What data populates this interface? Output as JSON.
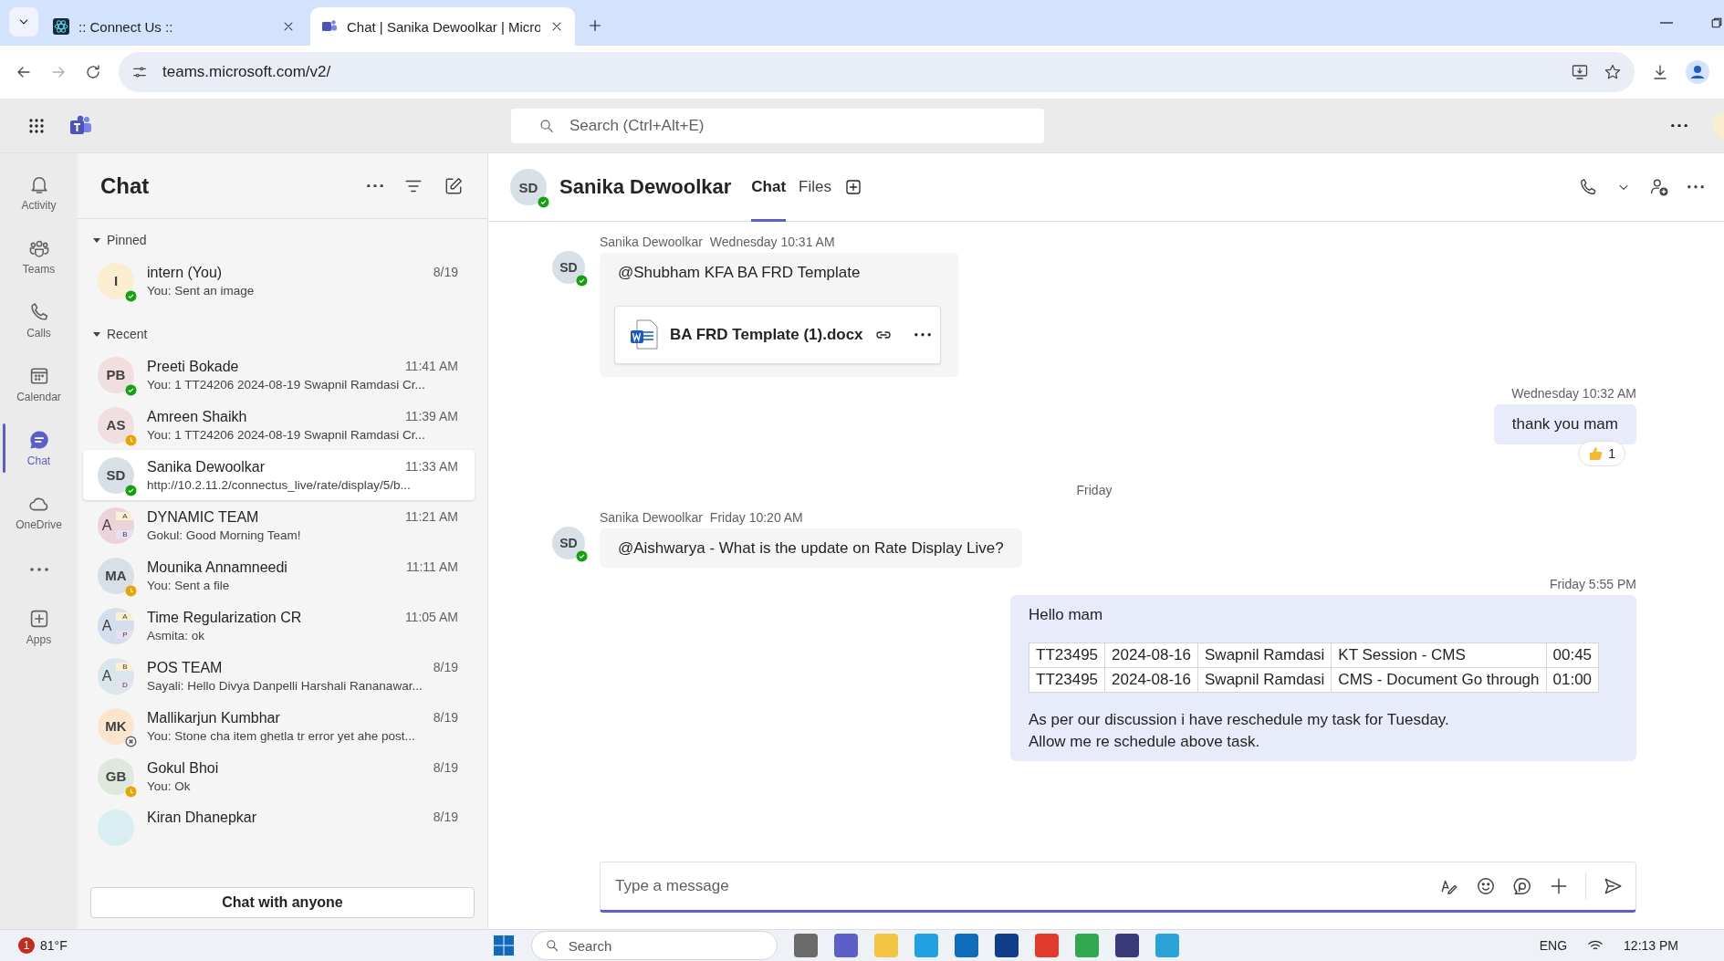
{
  "browser": {
    "tabs": [
      {
        "title": ":: Connect Us ::",
        "selected": false
      },
      {
        "title": "Chat | Sanika Dewoolkar | Micro",
        "selected": true
      }
    ],
    "url": "teams.microsoft.com/v2/"
  },
  "topbar": {
    "search_placeholder": "Search (Ctrl+Alt+E)"
  },
  "rail": [
    {
      "kind": "activity",
      "label": "Activity",
      "selected": false
    },
    {
      "kind": "teams",
      "label": "Teams",
      "selected": false
    },
    {
      "kind": "calls",
      "label": "Calls",
      "selected": false
    },
    {
      "kind": "calendar",
      "label": "Calendar",
      "selected": false
    },
    {
      "kind": "chat",
      "label": "Chat",
      "selected": true
    },
    {
      "kind": "onedrive",
      "label": "OneDrive",
      "selected": false
    },
    {
      "kind": "more"
    },
    {
      "kind": "apps",
      "label": "Apps",
      "selected": false
    }
  ],
  "chat_list": {
    "title": "Chat",
    "sections": [
      {
        "label": "Pinned",
        "expanded": true,
        "items": [
          {
            "name": "intern (You)",
            "time": "8/19",
            "preview": "You: Sent an image",
            "initials": "I",
            "color": "#fbedcf",
            "status": {
              "kind": "available",
              "color": "#13a10e"
            },
            "selected": false
          }
        ]
      },
      {
        "label": "Recent",
        "expanded": true,
        "items": [
          {
            "name": "Preeti Bokade",
            "time": "11:41 AM",
            "preview": "You: 1 TT24206 2024-08-19 Swapnil Ramdasi Cr...",
            "initials": "PB",
            "color": "#f1dede",
            "status": {
              "kind": "available",
              "color": "#13a10e"
            },
            "selected": false
          },
          {
            "name": "Amreen Shaikh",
            "time": "11:39 AM",
            "preview": "You: 1 TT24206 2024-08-19 Swapnil Ramdasi Cr...",
            "initials": "AS",
            "color": "#f1dede",
            "status": {
              "kind": "away",
              "color": "#eaa300"
            },
            "selected": false
          },
          {
            "name": "Sanika Dewoolkar",
            "time": "11:33 AM",
            "preview": "http://10.2.11.2/connectus_live/rate/display/5/b...",
            "initials": "SD",
            "color": "#d6e0e6",
            "status": {
              "kind": "available",
              "color": "#13a10e"
            },
            "selected": true
          },
          {
            "name": "DYNAMIC TEAM",
            "time": "11:21 AM",
            "preview": "Gokul: Good Morning Team!",
            "group": {
              "main": "A",
              "small": [
                "A",
                "B"
              ]
            },
            "color": "#ecd3d9",
            "selected": false
          },
          {
            "name": "Mounika Annamneedi",
            "time": "11:11 AM",
            "preview": "You: Sent a file",
            "initials": "MA",
            "color": "#d6e0e6",
            "status": {
              "kind": "away",
              "color": "#eaa300"
            },
            "selected": false
          },
          {
            "name": "Time Regularization CR",
            "time": "11:05 AM",
            "preview": "Asmita: ok",
            "group": {
              "main": "A",
              "small": [
                "A",
                "P"
              ]
            },
            "color": "#d3deef",
            "selected": false
          },
          {
            "name": "POS TEAM",
            "time": "8/19",
            "preview": "Sayali: Hello Divya Danpelli Harshali Rananawar...",
            "group": {
              "main": "A",
              "small": [
                "B",
                "D"
              ]
            },
            "color": "#d9e6ec",
            "selected": false
          },
          {
            "name": "Mallikarjun Kumbhar",
            "time": "8/19",
            "preview": "You: Stone cha item ghetla tr error yet ahe post...",
            "initials": "MK",
            "color": "#fbe5cf",
            "status": {
              "kind": "offline",
              "color": "#616161"
            },
            "selected": false
          },
          {
            "name": "Gokul Bhoi",
            "time": "8/19",
            "preview": "You: Ok",
            "initials": "GB",
            "color": "#dfe8dc",
            "status": {
              "kind": "away",
              "color": "#eaa300"
            },
            "selected": false
          },
          {
            "name": "Kiran Dhanepkar",
            "time": "8/19",
            "color": "#d8eef2",
            "selected": false
          }
        ]
      }
    ],
    "chat_with_anyone": "Chat with anyone"
  },
  "conversation": {
    "initials": "SD",
    "status": {
      "kind": "available",
      "color": "#13a10e"
    },
    "name": "Sanika Dewoolkar",
    "tabs": [
      {
        "label": "Chat",
        "selected": true
      },
      {
        "label": "Files",
        "selected": false
      }
    ],
    "messages": [
      {
        "kind": "incoming",
        "sender": "Sanika Dewoolkar",
        "time": "Wednesday 10:31 AM",
        "initials": "SD",
        "status": {
          "kind": "available",
          "color": "#13a10e"
        },
        "text": "@Shubham KFA BA FRD Template",
        "attachment": "BA FRD Template (1).docx"
      },
      {
        "kind": "outgoing",
        "time": "Wednesday 10:32 AM",
        "text": "thank you mam",
        "reaction_count": "1"
      },
      {
        "kind": "divider",
        "label": "Friday"
      },
      {
        "kind": "incoming",
        "sender": "Sanika Dewoolkar",
        "time": "Friday 10:20 AM",
        "initials": "SD",
        "status": {
          "kind": "available",
          "color": "#13a10e"
        },
        "text": "@Aishwarya - What is the update on Rate Display Live?"
      },
      {
        "kind": "outgoing",
        "time": "Friday 5:55 PM",
        "text": "Hello mam",
        "table": [
          [
            "TT23495",
            "2024-08-16",
            "Swapnil Ramdasi",
            "KT Session - CMS",
            "00:45"
          ],
          [
            "TT23495",
            "2024-08-16",
            "Swapnil Ramdasi",
            "CMS - Document Go through",
            "01:00"
          ]
        ],
        "lines": [
          "As per our discussion i have reschedule my task for Tuesday.",
          "Allow me re schedule above task."
        ]
      }
    ],
    "composer_placeholder": "Type a message"
  },
  "taskbar": {
    "weather_badge": "1",
    "temperature": "81°F",
    "search": "Search",
    "language": "ENG",
    "clock": "12:13 PM"
  }
}
